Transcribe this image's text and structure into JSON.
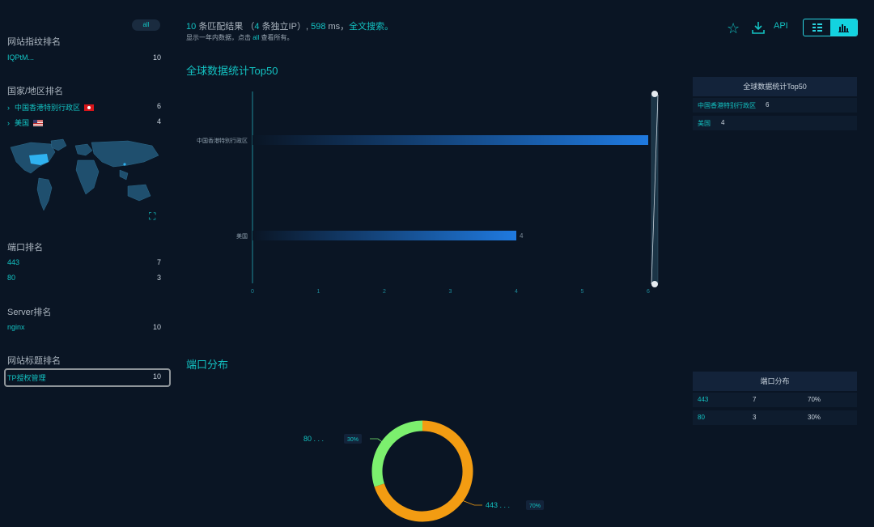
{
  "sidebar": {
    "all_label": "all",
    "fingerprint": {
      "title": "网站指纹排名",
      "items": [
        {
          "name": "IQPtM...",
          "count": "10"
        }
      ]
    },
    "country": {
      "title": "国家/地区排名",
      "items": [
        {
          "name": "中国香港特别行政区",
          "count": "6"
        },
        {
          "name": "美国",
          "count": "4"
        }
      ]
    },
    "port": {
      "title": "端口排名",
      "items": [
        {
          "name": "443",
          "count": "7"
        },
        {
          "name": "80",
          "count": "3"
        }
      ]
    },
    "server": {
      "title": "Server排名",
      "items": [
        {
          "name": "nginx",
          "count": "10"
        }
      ]
    },
    "webtitle": {
      "title": "网站标题排名",
      "items": [
        {
          "name": "TP授权管理",
          "count": "10"
        }
      ]
    }
  },
  "header": {
    "count": "10",
    "count_suffix": "条匹配结果",
    "ip_prefix": "（",
    "ip_count": "4",
    "ip_suffix": "条独立IP）,",
    "ms": "598",
    "ms_unit": "ms，",
    "fulltext": "全文搜索。",
    "sub_text_1": "显示一年内数据，点击",
    "sub_link": "all",
    "sub_text_2": "查看所有。",
    "api_label": "API"
  },
  "sections": {
    "global_title": "全球数据统计Top50",
    "port_title": "端口分布"
  },
  "right_tables": {
    "global": {
      "header": "全球数据统计Top50",
      "rows": [
        {
          "name": "中国香港特别行政区",
          "value": "6"
        },
        {
          "name": "美国",
          "value": "4"
        }
      ]
    },
    "port": {
      "header": "端口分布",
      "rows": [
        {
          "name": "443",
          "value": "7",
          "pct": "70%"
        },
        {
          "name": "80",
          "value": "3",
          "pct": "30%"
        }
      ]
    }
  },
  "chart_data": [
    {
      "type": "bar",
      "orientation": "horizontal",
      "title": "全球数据统计Top50",
      "categories": [
        "中国香港特别行政区",
        "美国"
      ],
      "values": [
        6,
        4
      ],
      "xlim": [
        0,
        6
      ],
      "x_ticks": [
        "0",
        "1",
        "2",
        "3",
        "4",
        "5",
        "6"
      ]
    },
    {
      "type": "pie",
      "title": "端口分布",
      "labels": [
        "443",
        "80"
      ],
      "values": [
        7,
        3
      ],
      "percents": [
        "70%",
        "30%"
      ],
      "colors": [
        "#f39c12",
        "#7cf06e"
      ]
    }
  ],
  "colors": {
    "accent": "#13c2c2",
    "background": "#0a1524",
    "bar": "#1e6fd9",
    "donut_443": "#f39c12",
    "donut_80": "#7cf06e"
  }
}
